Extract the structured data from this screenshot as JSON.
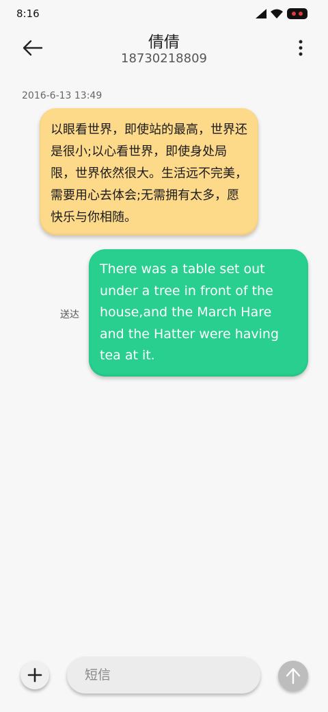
{
  "status_bar": {
    "time": "8:16",
    "icons": [
      "signal-icon",
      "wifi-icon",
      "battery-icon"
    ]
  },
  "header": {
    "back_icon": "arrow-left-icon",
    "title": "倩倩",
    "phone": "18730218809",
    "more_icon": "more-vertical-icon"
  },
  "conversation": {
    "timestamp": "2016-6-13 13:49",
    "received_message": "以眼看世界，即使站的最高，世界还是很小;以心看世界，即使身处局限，世界依然很大。生活远不完美，需要用心去体会;无需拥有太多，愿快乐与你相随。",
    "sent_message": "There was a table set out under a tree in front of the house,and the March Hare and the Hatter were having tea at it.",
    "sent_status": "送达"
  },
  "composer": {
    "add_icon": "plus-icon",
    "input_placeholder": "短信",
    "input_value": "",
    "send_icon": "arrow-up-icon"
  },
  "colors": {
    "background": "#f7f7f7",
    "received_bubble": "#fdd98a",
    "sent_bubble": "#28cf8e",
    "send_button": "#bdbdbd",
    "battery_accent": "#e0383e"
  }
}
